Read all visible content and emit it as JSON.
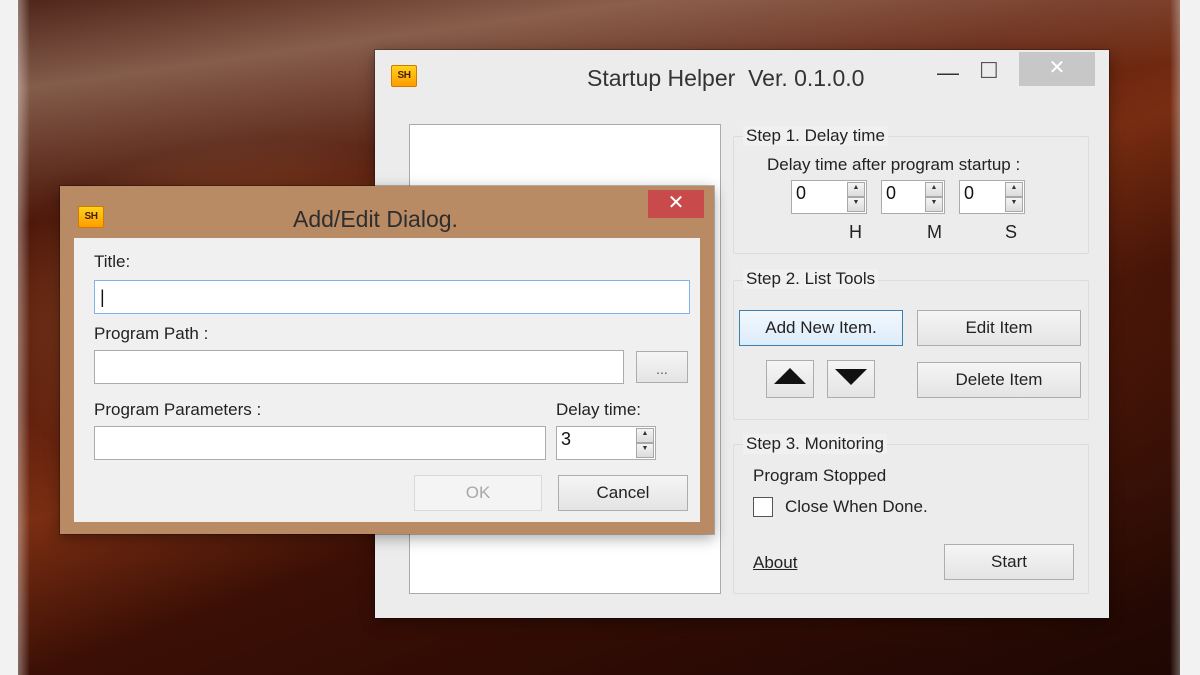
{
  "main_window": {
    "icon_text": "SH",
    "title": "Startup Helper  Ver. 0.1.0.0",
    "minimize_glyph": "—",
    "maximize_glyph": "☐",
    "close_glyph": "✕",
    "step1": {
      "title": "Step 1. Delay time",
      "subtitle": "Delay time after program startup :",
      "hours_value": "0",
      "minutes_value": "0",
      "seconds_value": "0",
      "hours_label": "H",
      "minutes_label": "M",
      "seconds_label": "S"
    },
    "step2": {
      "title": "Step 2. List Tools",
      "add_label": "Add New Item.",
      "edit_label": "Edit Item",
      "delete_label": "Delete Item"
    },
    "step3": {
      "title": "Step 3. Monitoring",
      "status": "Program Stopped",
      "close_when_done": "Close When Done.",
      "about": "About",
      "start_label": "Start"
    }
  },
  "dialog": {
    "icon_text": "SH",
    "title": "Add/Edit Dialog.",
    "close_glyph": "✕",
    "title_label": "Title:",
    "title_value": "|",
    "path_label": "Program Path :",
    "path_value": "",
    "browse_label": "...",
    "params_label": "Program Parameters :",
    "params_value": "",
    "delay_label": "Delay time:",
    "delay_value": "3",
    "ok_label": "OK",
    "cancel_label": "Cancel"
  }
}
